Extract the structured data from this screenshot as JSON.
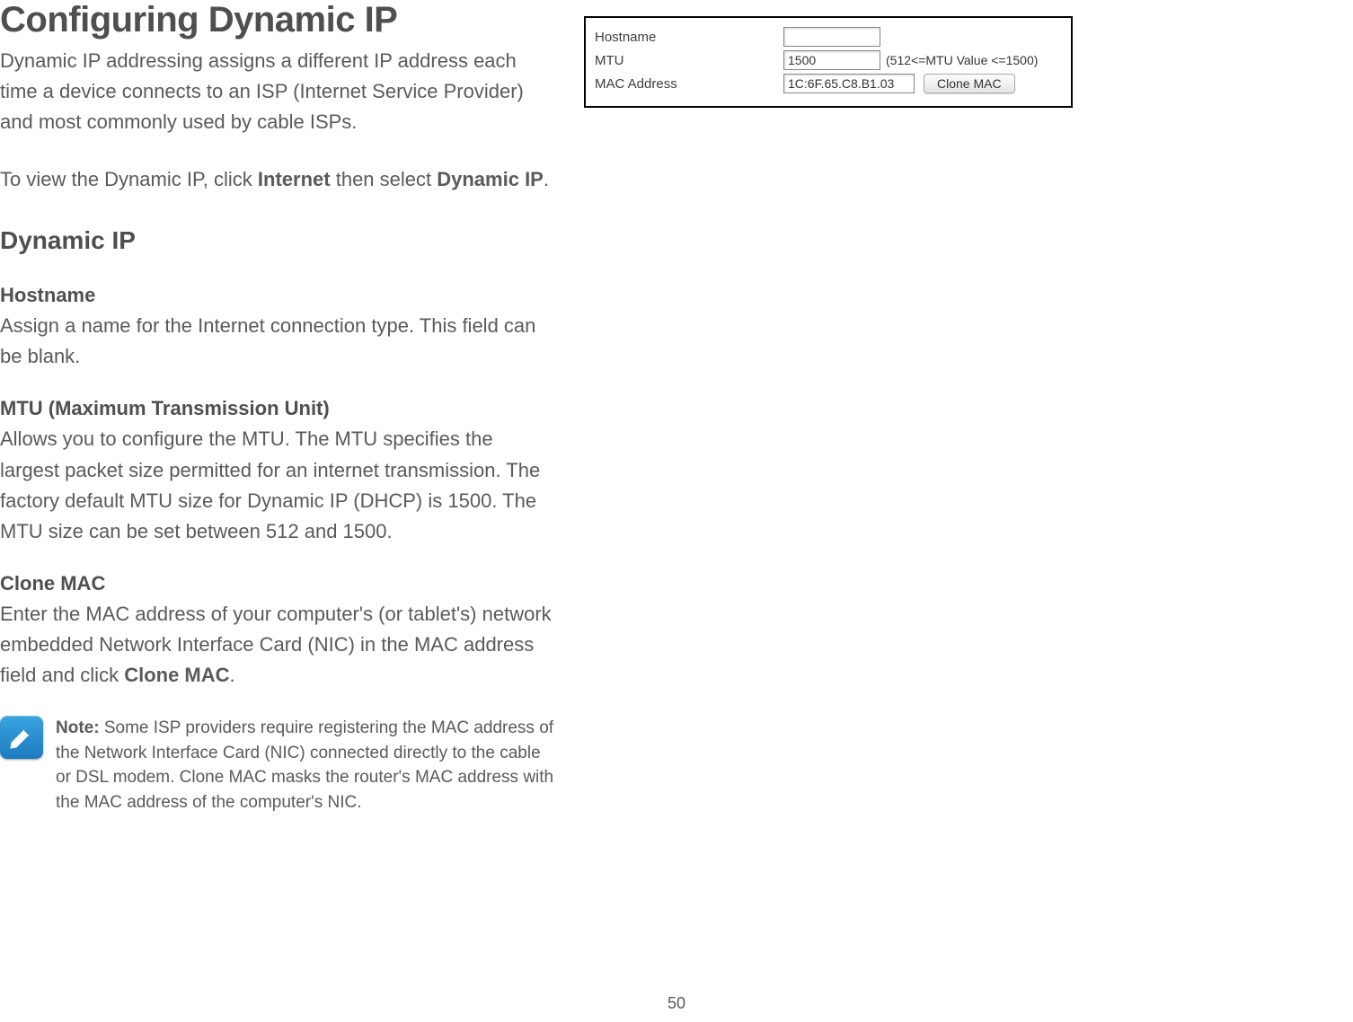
{
  "page": {
    "title": "Configuring Dynamic IP",
    "intro": "Dynamic IP addressing assigns a different IP address each time a device connects to an ISP (Internet Service Provider) and most commonly used by cable ISPs.",
    "nav_pre": "To view the Dynamic IP, click ",
    "nav_b1": "Internet",
    "nav_mid": " then select ",
    "nav_b2": "Dynamic IP",
    "nav_post": ".",
    "subheading": "Dynamic IP",
    "sections": {
      "hostname": {
        "title": "Hostname",
        "body": "Assign a name for the Internet connection type. This field can be blank."
      },
      "mtu": {
        "title": "MTU (Maximum Transmission Unit)",
        "body": "Allows you to configure the MTU. The MTU specifies the largest packet size permitted for an internet transmission. The factory default MTU size for Dynamic IP (DHCP) is 1500. The MTU size can be set between 512 and 1500."
      },
      "clone": {
        "title": "Clone MAC",
        "body_pre": "Enter the MAC address of your computer's (or tablet's) network embedded Network Interface Card (NIC) in the MAC address field and click ",
        "body_b": "Clone MAC",
        "body_post": "."
      }
    },
    "note": {
      "label": "Note:",
      "body": " Some ISP providers require registering the MAC address of the Network Interface Card (NIC) connected directly to the cable or DSL modem. Clone MAC masks the router's MAC address with the MAC address of the computer's NIC."
    },
    "number": "50"
  },
  "form": {
    "hostname_label": "Hostname",
    "hostname_value": "",
    "mtu_label": "MTU",
    "mtu_value": "1500",
    "mtu_range": "(512<=MTU Value <=1500)",
    "mac_label": "MAC Address",
    "mac_value": "1C:6F.65.C8.B1.03",
    "clone_btn": "Clone MAC"
  }
}
